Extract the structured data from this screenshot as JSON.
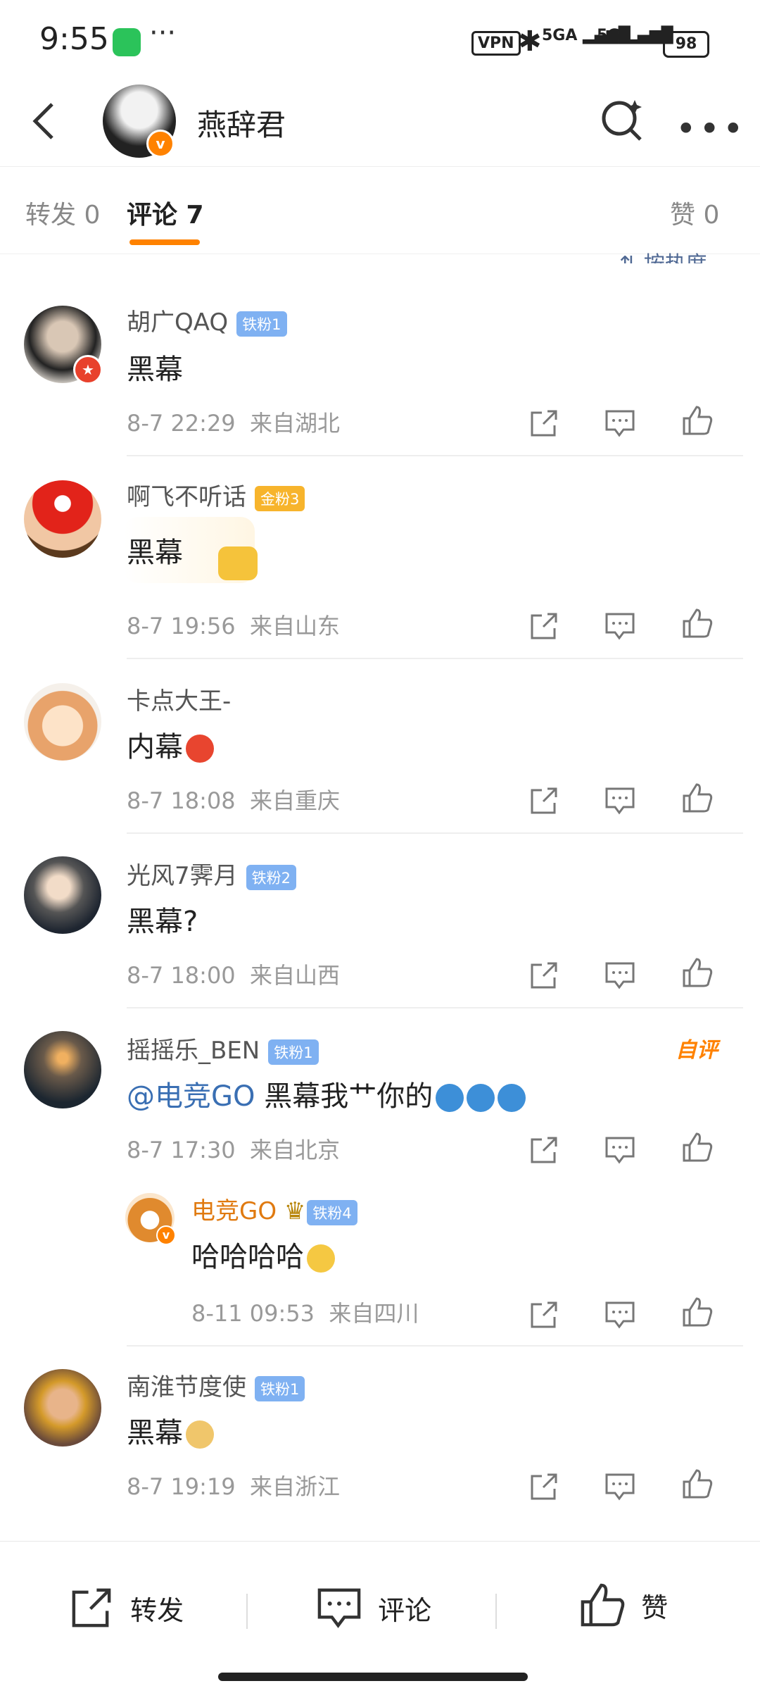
{
  "status_bar": {
    "time": "9:55",
    "dots": "···",
    "vpn": "VPN",
    "sig1": "5GA",
    "sig2": "5G",
    "battery": "98"
  },
  "header": {
    "name": "燕辞君",
    "verified": "v"
  },
  "tabs": [
    {
      "label": "转发 0"
    },
    {
      "label": "评论 7"
    },
    {
      "label": "赞 0"
    }
  ],
  "sort_partial": "按热度",
  "comments": [
    {
      "user": "胡广QAQ",
      "badge": "铁粉1",
      "text": "黑幕",
      "date": "8-7 22:29",
      "loc": "来自湖北"
    },
    {
      "user": "啊飞不听话",
      "badge": "金粉3",
      "text": "黑幕",
      "date": "8-7 19:56",
      "loc": "来自山东"
    },
    {
      "user": "卡点大王-",
      "text": "内幕",
      "date": "8-7 18:08",
      "loc": "来自重庆"
    },
    {
      "user": "光风7霁月",
      "badge": "铁粉2",
      "text": "黑幕?",
      "date": "8-7 18:00",
      "loc": "来自山西"
    },
    {
      "user": "摇摇乐_BEN",
      "badge": "铁粉1",
      "mention": "@电竞GO",
      "text": " 黑幕我艹你的",
      "date": "8-7 17:30",
      "loc": "来自北京",
      "tag": "自评"
    },
    {
      "user": "南淮节度使",
      "badge": "铁粉1",
      "text": "黑幕",
      "date": "8-7 19:19",
      "loc": "来自浙江"
    }
  ],
  "reply": {
    "user": "电竞GO",
    "badge": "铁粉4",
    "text": "哈哈哈哈",
    "date": "8-11 09:53",
    "loc": "来自四川",
    "verified": "v"
  },
  "bottom": {
    "forward": "转发",
    "comment": "评论",
    "like": "赞"
  },
  "colors": {
    "accent": "#ff8200",
    "iron_badge": "#7fb1f2",
    "gold_badge": "#f7b42c",
    "link": "#3a6fb3"
  }
}
